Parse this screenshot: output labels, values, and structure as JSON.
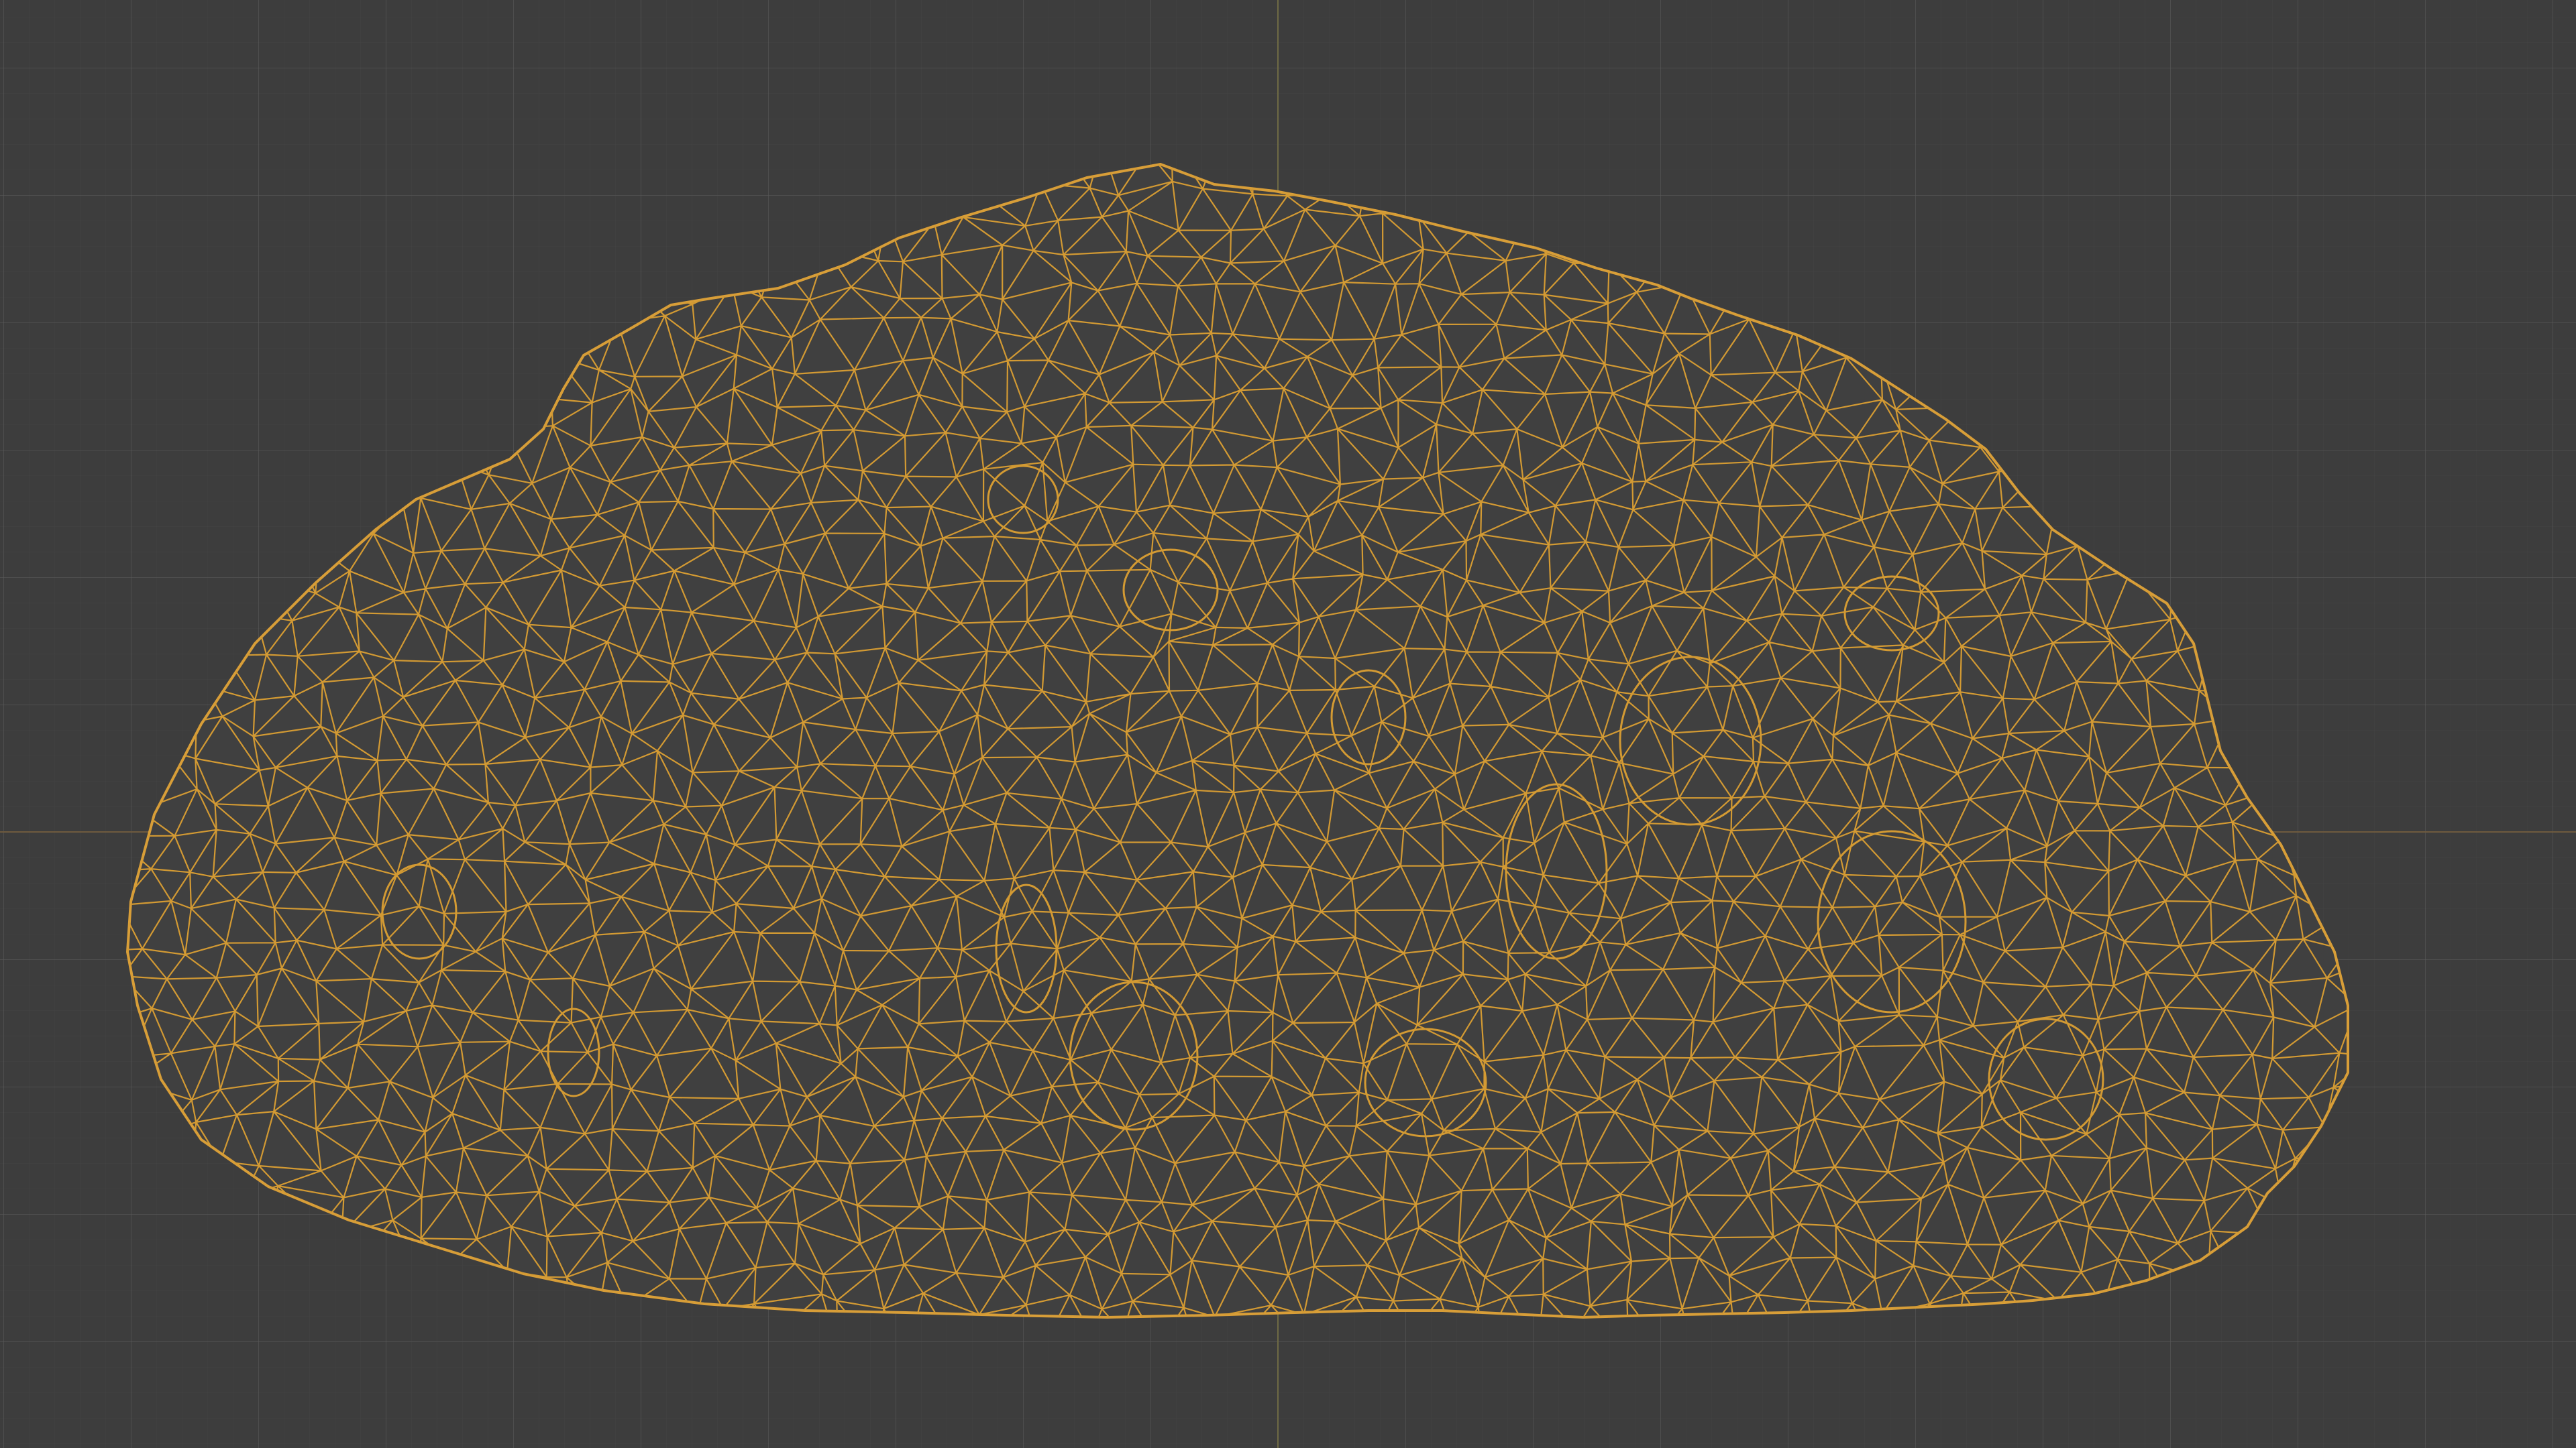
{
  "app": {
    "view": "wireframe-viewport",
    "object": "rock-mesh"
  },
  "colors": {
    "background": "#3d3d3d",
    "grid_major": "#5a5a5a",
    "grid_minor": "#464646",
    "wireframe": "#d39a33",
    "axis_x": "#6e5a3e",
    "axis_y": "#6e6a44"
  }
}
